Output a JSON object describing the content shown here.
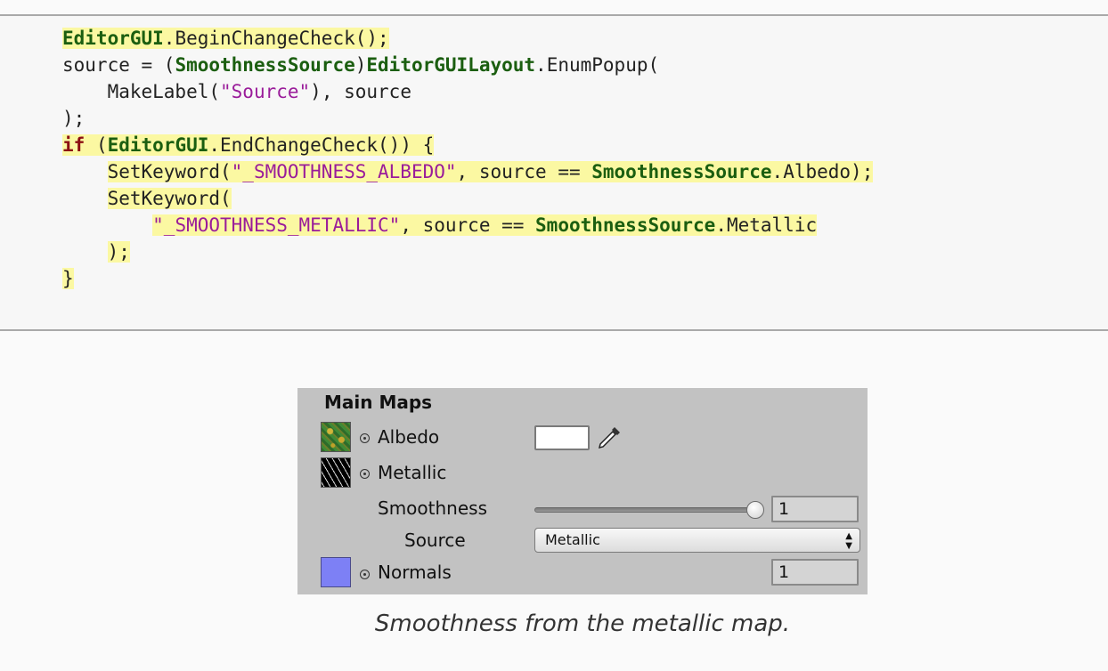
{
  "code": {
    "line1": {
      "type": "EditorGUI",
      "rest": ".BeginChangeCheck();"
    },
    "line2": {
      "pre": "source = (",
      "type1": "SmoothnessSource",
      "mid": ")",
      "type2": "EditorGUILayout",
      "rest": ".EnumPopup("
    },
    "line3": {
      "pre": "    MakeLabel(",
      "str": "\"Source\"",
      "rest": "), source"
    },
    "line4": {
      "text": ");"
    },
    "line5": {
      "kw": "if",
      "pre": " (",
      "type": "EditorGUI",
      "rest": ".EndChangeCheck()) {"
    },
    "line6": {
      "pre": "SetKeyword(",
      "str": "\"_SMOOTHNESS_ALBEDO\"",
      "mid": ", source == ",
      "type": "SmoothnessSource",
      "rest": ".Albedo);"
    },
    "line7": {
      "text": "SetKeyword("
    },
    "line8": {
      "str": "\"_SMOOTHNESS_METALLIC\"",
      "mid": ", source == ",
      "type": "SmoothnessSource",
      "rest": ".Metallic"
    },
    "line9": {
      "text": ");"
    },
    "line10": {
      "text": "}"
    }
  },
  "inspector": {
    "title": "Main Maps",
    "albedo_label": "Albedo",
    "metallic_label": "Metallic",
    "smoothness_label": "Smoothness",
    "smoothness_value": "1",
    "smoothness_slider": 1.0,
    "source_label": "Source",
    "source_selected": "Metallic",
    "normals_label": "Normals",
    "normals_value": "1",
    "albedo_color": "#ffffff",
    "normals_color": "#7d80f5"
  },
  "caption": "Smoothness from the metallic map.",
  "colors": {
    "highlight": "#fbf8a2",
    "type_green": "#1b5e10",
    "keyword_red": "#8b0f12",
    "string_purple": "#9a1c9a"
  }
}
